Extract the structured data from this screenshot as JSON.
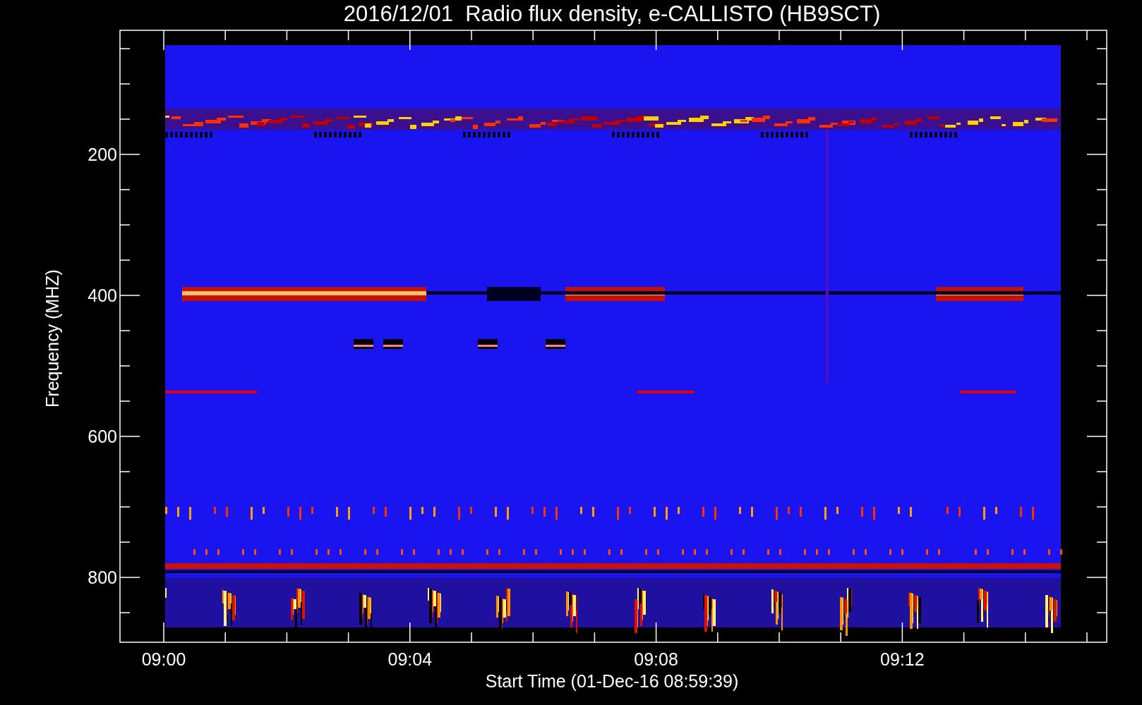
{
  "title": "2016/12/01  Radio flux density, e-CALLISTO (HB9SCT)",
  "y_axis": {
    "label": "Frequency (MHZ)",
    "ticks": [
      "200",
      "400",
      "600",
      "800"
    ]
  },
  "x_axis": {
    "label": "Start Time (01-Dec-16 08:59:39)",
    "ticks": [
      "09:00",
      "09:04",
      "09:08",
      "09:12"
    ]
  }
}
